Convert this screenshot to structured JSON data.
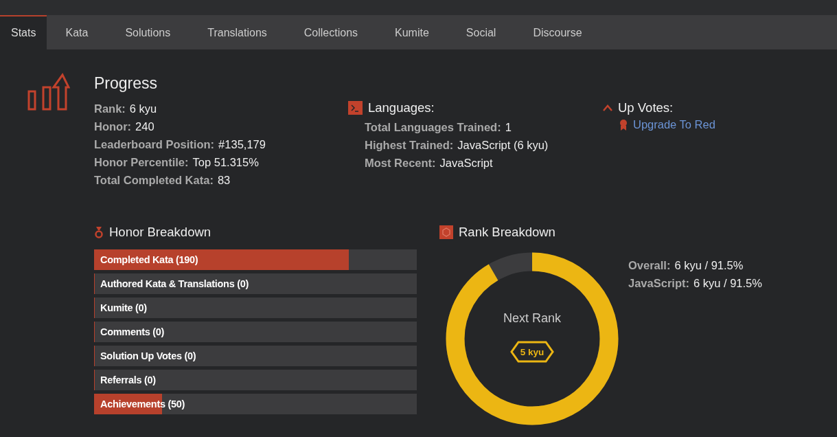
{
  "tabs": [
    {
      "label": "Stats",
      "selected": true
    },
    {
      "label": "Kata",
      "selected": false
    },
    {
      "label": "Solutions",
      "selected": false
    },
    {
      "label": "Translations",
      "selected": false
    },
    {
      "label": "Collections",
      "selected": false
    },
    {
      "label": "Kumite",
      "selected": false
    },
    {
      "label": "Social",
      "selected": false
    },
    {
      "label": "Discourse",
      "selected": false
    }
  ],
  "progress": {
    "title": "Progress",
    "stats": [
      {
        "label": "Rank:",
        "value": "6 kyu"
      },
      {
        "label": "Honor:",
        "value": "240"
      },
      {
        "label": "Leaderboard Position:",
        "value": "#135,179"
      },
      {
        "label": "Honor Percentile:",
        "value": "Top 51.315%"
      },
      {
        "label": "Total Completed Kata:",
        "value": "83"
      }
    ]
  },
  "languages": {
    "title": "Languages:",
    "stats": [
      {
        "label": "Total Languages Trained:",
        "value": "1"
      },
      {
        "label": "Highest Trained:",
        "value": "JavaScript (6 kyu)"
      },
      {
        "label": "Most Recent:",
        "value": "JavaScript"
      }
    ]
  },
  "up_votes": {
    "title": "Up Votes:",
    "link": "Upgrade To Red"
  },
  "honor_breakdown": {
    "title": "Honor Breakdown",
    "rows": [
      {
        "label": "Completed Kata (190)",
        "level": 0.79
      },
      {
        "label": "Authored Kata & Translations (0)",
        "level": 0
      },
      {
        "label": "Kumite (0)",
        "level": 0
      },
      {
        "label": "Comments (0)",
        "level": 0
      },
      {
        "label": "Solution Up Votes (0)",
        "level": 0
      },
      {
        "label": "Referrals (0)",
        "level": 0
      },
      {
        "label": "Achievements (50)",
        "level": 0.21
      }
    ]
  },
  "rank_breakdown": {
    "title": "Rank Breakdown",
    "ring": {
      "label": "Next Rank",
      "badge": "5 kyu",
      "level": 0.915
    },
    "stats": [
      {
        "label": "Overall:",
        "value": "6 kyu / 91.5%"
      },
      {
        "label": "JavaScript:",
        "value": "6 kyu / 91.5%"
      }
    ]
  }
}
